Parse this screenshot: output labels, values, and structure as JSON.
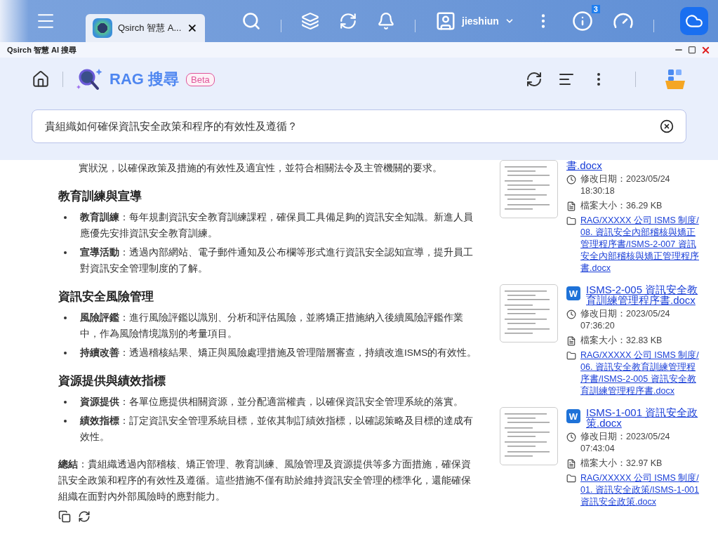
{
  "top_bar": {
    "tab": {
      "title": "Qsirch 智慧 A...",
      "selected": true
    },
    "user": "jieshiun",
    "notification_count": "3"
  },
  "window": {
    "title": "Qsirch 智慧 AI 搜尋"
  },
  "header": {
    "title": "RAG 搜尋",
    "badge": "Beta"
  },
  "search": {
    "value": "貴組織如何確保資訊安全政策和程序的有效性及遵循？"
  },
  "answer": [
    {
      "kind": "continuation",
      "text": "實狀況，以確保政策及措施的有效性及適宜性，並符合相關法令及主管機關的要求。"
    },
    {
      "kind": "heading",
      "text": "教育訓練與宣導"
    },
    {
      "kind": "bullet",
      "text": "**教育訓練**：每年規劃資訊安全教育訓練課程，確保員工具備足夠的資訊安全知識。新進人員應優先安排資訊安全教育訓練。"
    },
    {
      "kind": "bullet",
      "text": "**宣導活動**：透過內部網站、電子郵件通知及公布欄等形式進行資訊安全認知宣導，提升員工對資訊安全管理制度的了解。"
    },
    {
      "kind": "heading",
      "text": "資訊安全風險管理"
    },
    {
      "kind": "bullet",
      "text": "**風險評鑑**：進行風險評鑑以識別、分析和評估風險，並將矯正措施納入後續風險評鑑作業中，作為風險情境識別的考量項目。"
    },
    {
      "kind": "bullet",
      "text": "**持續改善**：透過稽核結果、矯正與風險處理措施及管理階層審查，持續改進ISMS的有效性。"
    },
    {
      "kind": "heading",
      "text": "資源提供與績效指標"
    },
    {
      "kind": "bullet",
      "text": "**資源提供**：各單位應提供相關資源，並分配適當權責，以確保資訊安全管理系統的落實。"
    },
    {
      "kind": "bullet",
      "text": "**績效指標**：訂定資訊安全管理系統目標，並依其制訂績效指標，以確認策略及目標的達成有效性。"
    },
    {
      "kind": "summary",
      "text": "**總結**：貴組織透過內部稽核、矯正管理、教育訓練、風險管理及資源提供等多方面措施，確保資訊安全政策和程序的有效性及遵循。這些措施不僅有助於維持資訊安全管理的標準化，還能確保組織在面對內外部風險時的應對能力。"
    }
  ],
  "sources": [
    {
      "title": "書.docx",
      "modified": "修改日期：2023/05/24 18:30:18",
      "size": "檔案大小：36.29 KB",
      "path": "RAG/XXXXX 公司 ISMS 制度/08. 資訊安全內部稽核與矯正管理程序書/ISMS-2-007 資訊安全內部稽核與矯正管理程序書.docx"
    },
    {
      "title": "ISMS-2-005 資訊安全教育訓練管理程序書.docx",
      "file_badge": "W",
      "modified": "修改日期：2023/05/24 07:36:20",
      "size": "檔案大小：32.83 KB",
      "path": "RAG/XXXXX 公司 ISMS 制度/06. 資訊安全教育訓練管理程序書/ISMS-2-005 資訊安全教育訓練管理程序書.docx"
    },
    {
      "title": "ISMS-1-001 資訊安全政策.docx",
      "file_badge": "W",
      "modified": "修改日期：2023/05/24 07:43:04",
      "size": "檔案大小：32.97 KB",
      "path": "RAG/XXXXX 公司 ISMS 制度/01. 資訊安全政策/ISMS-1-001 資訊安全政策.docx"
    }
  ]
}
